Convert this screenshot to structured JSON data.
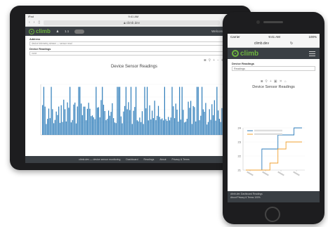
{
  "tablet": {
    "status_left": "iPad",
    "status_center": "9:41 AM",
    "status_right": "100%",
    "url": "climb.dev",
    "nav_item": "1.1",
    "nav_right": "Welcome, your user",
    "form": {
      "field1_label": "Address",
      "field1_value": "device telemetry stream — sensor read",
      "field2_label": "Device Readings",
      "field2_value": "none"
    },
    "chart_title": "Device Sensor Readings",
    "footer": [
      "climb.dev — device sensor monitoring",
      "Dashboard",
      "Readings",
      "About",
      "Privacy & Terms"
    ]
  },
  "phone": {
    "status_left": "Carrier",
    "status_center": "9:41 AM",
    "status_right": "100%",
    "url": "climb.dev",
    "form": {
      "label": "Device Readings",
      "value": "Readings"
    },
    "chart_title": "Device Sensor Readings",
    "footer_line1": "climb.dev  Dashboard  Readings",
    "footer_line2": "About  Privacy & Terms  100%"
  },
  "chart_data": [
    {
      "type": "bar",
      "title": "Device Sensor Readings",
      "ylabel": "",
      "ylim": [
        0,
        1
      ],
      "yticks": [],
      "legend": "none"
    },
    {
      "type": "line",
      "title": "Device Sensor Readings",
      "xlabel": "",
      "ylabel": "",
      "ylim": [
        21,
        24
      ],
      "yticks": [
        21,
        22,
        23,
        24
      ],
      "legend": "top-left",
      "series": [
        {
          "name": "",
          "color": "#2b7bb9",
          "values": [
            21,
            21,
            22.5,
            22.5,
            23.5,
            23.5,
            24,
            24
          ]
        },
        {
          "name": "",
          "color": "#f0a030",
          "values": [
            21,
            21,
            21,
            21.5,
            22.5,
            23,
            23,
            23
          ]
        }
      ]
    }
  ]
}
